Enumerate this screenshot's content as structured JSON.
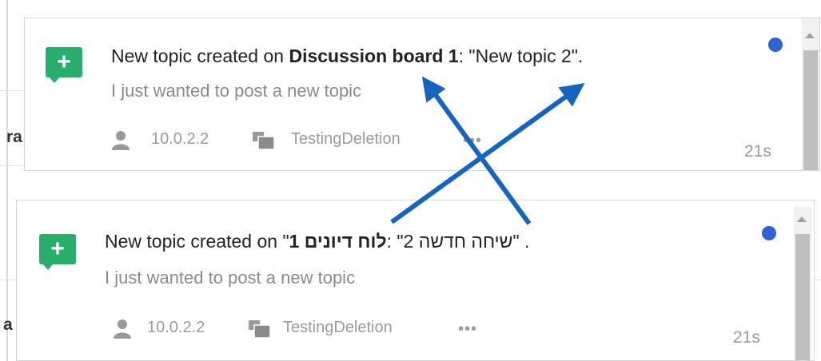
{
  "cards": [
    {
      "title_prefix": "New topic created on ",
      "board": "Discussion board 1",
      "title_mid": ": \"",
      "topic": "New topic 2",
      "title_suffix": "\".",
      "excerpt": "I just wanted to post a new topic",
      "ip": "10.0.2.2",
      "group": "TestingDeletion",
      "more": "•••",
      "time": "21s"
    },
    {
      "title_prefix": "New topic created on ",
      "board": "לוח דיונים 1",
      "title_mid": ": \"",
      "topic": "שיחה חדשה 2",
      "title_suffix": "\" .",
      "excerpt": "I just wanted to post a new topic",
      "ip": "10.0.2.2",
      "group": "TestingDeletion",
      "more": "•••",
      "time": "21s"
    }
  ],
  "background": {
    "clipped_letters": [
      "ra",
      "a"
    ]
  },
  "icons": {
    "badge": "plus-icon",
    "user": "user-icon",
    "group": "group-icon",
    "more": "more-icon",
    "unread": "unread-dot-icon",
    "scroll_up": "scroll-up-arrow-icon"
  },
  "colors": {
    "badge": "#27ae6b",
    "unread": "#2f62d6",
    "arrow": "#1565c0"
  }
}
